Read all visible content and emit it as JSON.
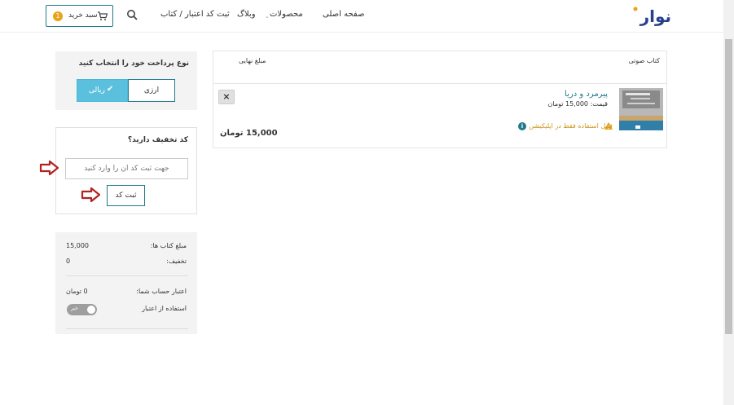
{
  "header": {
    "logo_text": "نوار",
    "nav": {
      "home": "صفحه اصلی",
      "products": "محصولات",
      "blog": "وبلاگ",
      "register_code": "ثبت کد اعتبار / کتاب"
    },
    "cart_label": "سبد خرید",
    "cart_count": "1",
    "search_icon": "search-icon",
    "cart_icon": "shopping-cart-icon"
  },
  "payment": {
    "title": "نوع پرداخت خود را انتخاب کنید",
    "rial_label": "ریالی",
    "arzi_label": "ارزی",
    "selected": "rial",
    "check_icon": "check-icon"
  },
  "discount": {
    "title": "کد تخفیف دارید؟",
    "input_placeholder": "جهت ثبت کد آن را وارد کنید",
    "input_value": "",
    "submit_label": "ثبت کد"
  },
  "summary": {
    "books_total_label": "مبلغ کتاب ها:",
    "books_total_value": "15,000",
    "discount_label": "تخفیف:",
    "discount_value": "0",
    "credit_label": "اعتبار حساب شما:",
    "credit_value": "0 تومان",
    "use_credit_label": "استفاده از اعتبار",
    "use_credit_toggle": "خیر"
  },
  "cart": {
    "col_book": "کتاب صوتی",
    "col_final": "مبلغ نهایی",
    "items": [
      {
        "title": "پیرمرد و دریا",
        "price": "قیمت: 15,000 تومان",
        "note": "قابل استفاده فقط در اپلیکیشن",
        "final_price": "15,000 تومان",
        "remove": "×"
      }
    ]
  },
  "colors": {
    "accent": "#1f7a8c",
    "primary_button": "#5bc0de",
    "badge": "#e8a317",
    "warning": "#c9961e",
    "arrow": "#b22222"
  }
}
